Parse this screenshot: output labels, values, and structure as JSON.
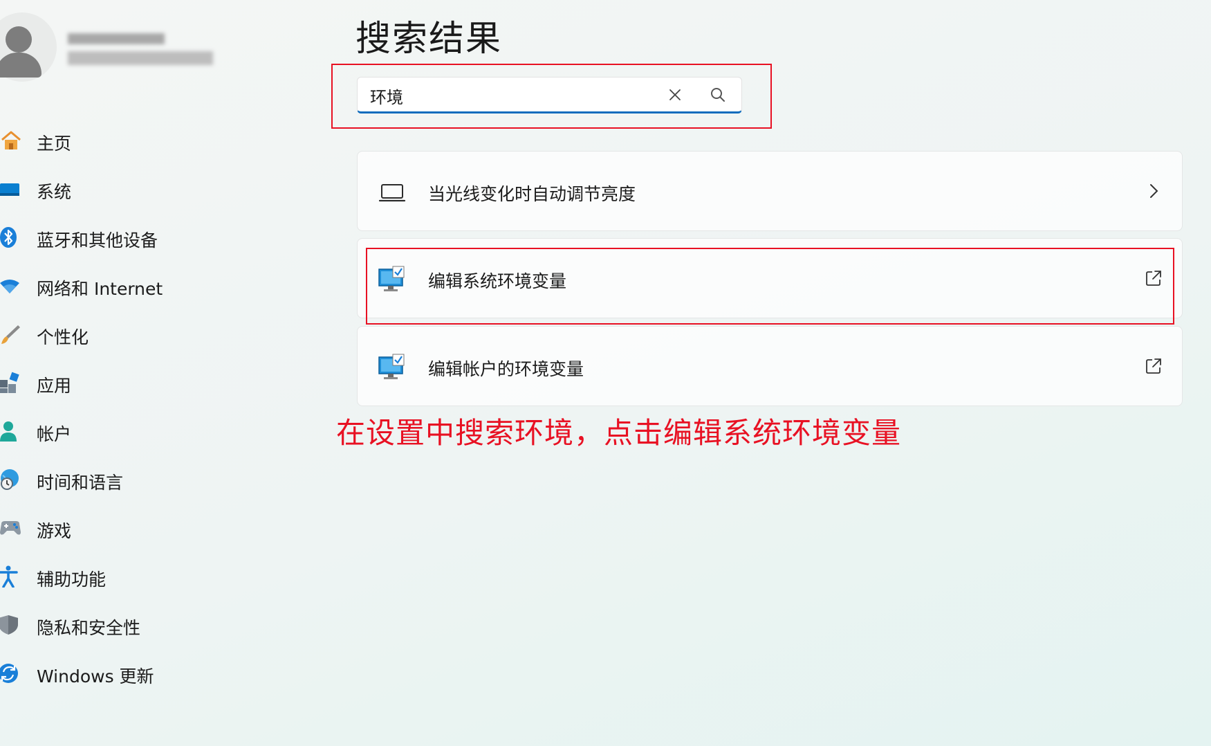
{
  "sidebar": {
    "items": [
      {
        "label": "主页",
        "icon": "home-icon"
      },
      {
        "label": "系统",
        "icon": "system-display-icon"
      },
      {
        "label": "蓝牙和其他设备",
        "icon": "bluetooth-icon"
      },
      {
        "label": "网络和 Internet",
        "icon": "wifi-icon"
      },
      {
        "label": "个性化",
        "icon": "paint-brush-icon"
      },
      {
        "label": "应用",
        "icon": "apps-icon"
      },
      {
        "label": "帐户",
        "icon": "account-person-icon"
      },
      {
        "label": "时间和语言",
        "icon": "globe-clock-icon"
      },
      {
        "label": "游戏",
        "icon": "gamepad-icon"
      },
      {
        "label": "辅助功能",
        "icon": "accessibility-icon"
      },
      {
        "label": "隐私和安全性",
        "icon": "shield-icon"
      },
      {
        "label": "Windows 更新",
        "icon": "windows-update-icon"
      }
    ]
  },
  "main": {
    "title": "搜索结果",
    "search": {
      "value": "环境",
      "placeholder": ""
    },
    "results": [
      {
        "label": "当光线变化时自动调节亮度",
        "icon": "laptop-icon",
        "trail_icon": "chevron-right-icon"
      },
      {
        "label": "编辑系统环境变量",
        "icon": "system-properties-monitor-icon",
        "trail_icon": "external-link-icon"
      },
      {
        "label": "编辑帐户的环境变量",
        "icon": "system-properties-monitor-icon",
        "trail_icon": "external-link-icon"
      }
    ]
  },
  "annotation": {
    "text": "在设置中搜索环境，点击编辑系统环境变量",
    "color": "#e81123"
  },
  "colors": {
    "accent": "#0f6cbd",
    "highlight_red": "#e81123"
  }
}
